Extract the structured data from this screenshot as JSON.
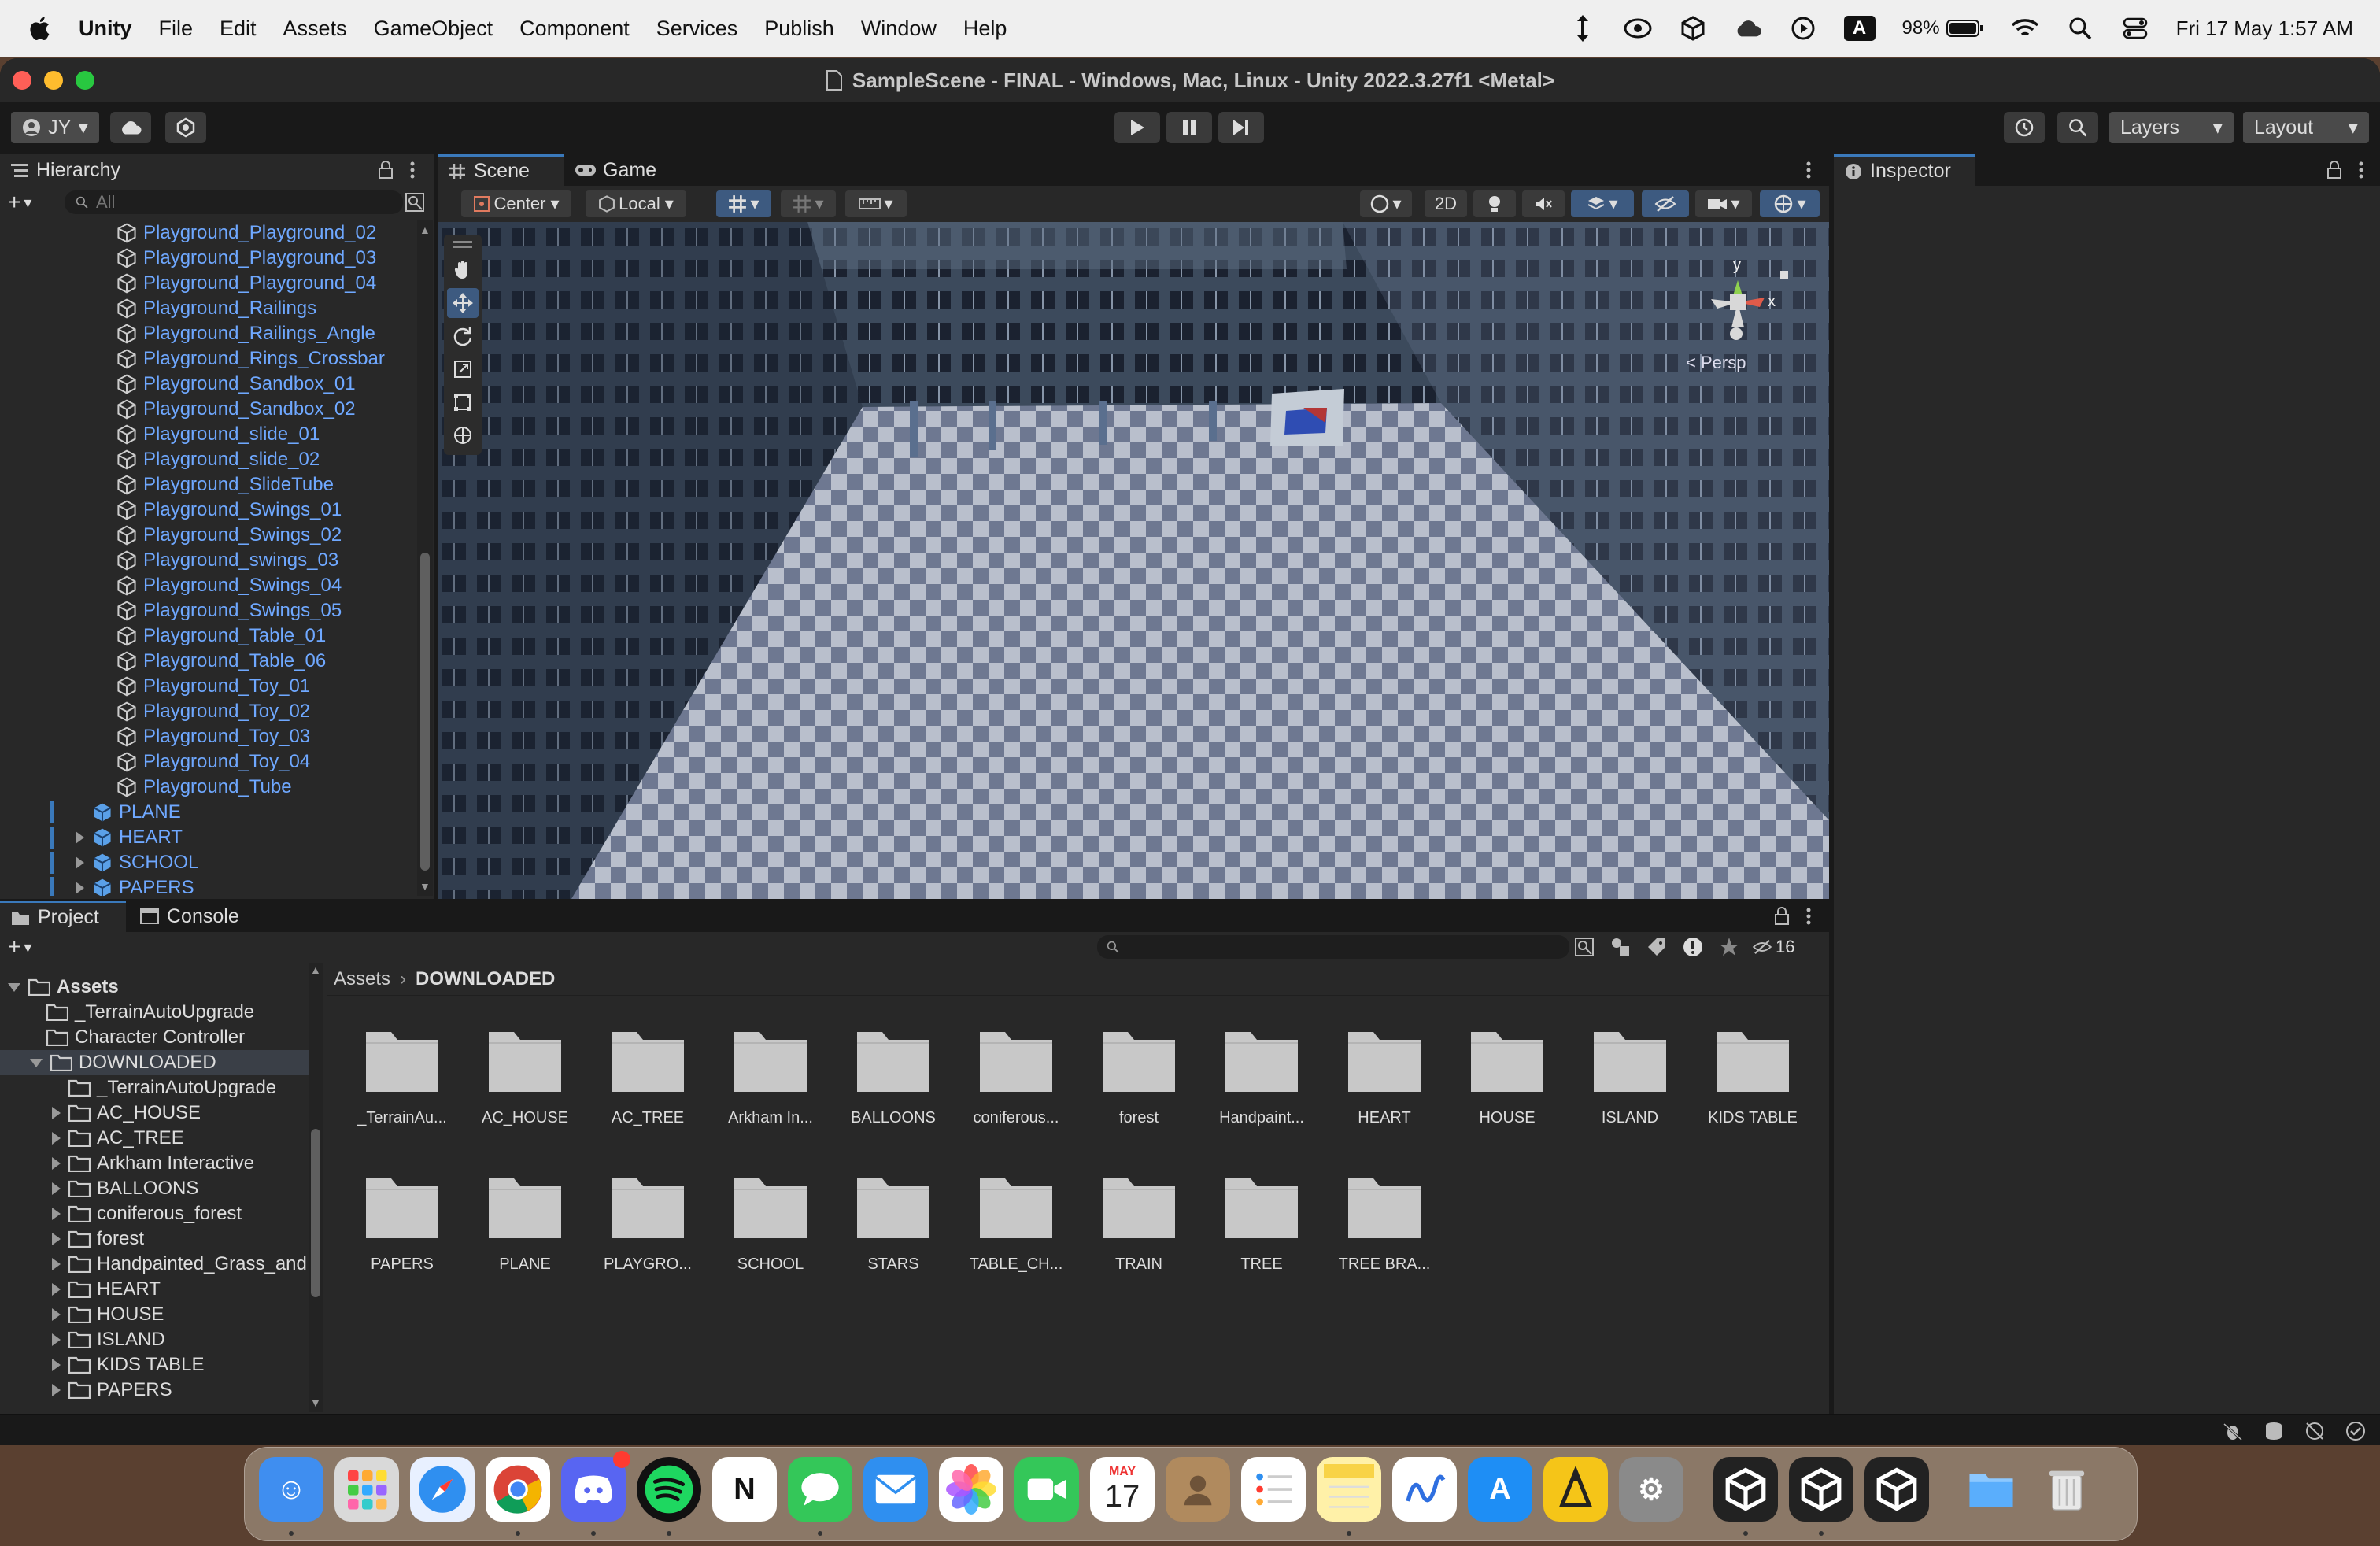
{
  "menubar": {
    "app": "Unity",
    "items": [
      "File",
      "Edit",
      "Assets",
      "GameObject",
      "Component",
      "Services",
      "Publish",
      "Window",
      "Help"
    ],
    "battery": "98%",
    "input_source": "A",
    "datetime": "Fri 17 May  1:57 AM"
  },
  "window": {
    "title": "SampleScene - FINAL - Windows, Mac, Linux - Unity 2022.3.27f1 <Metal>"
  },
  "toolbar": {
    "account": "JY",
    "layers": "Layers",
    "layout": "Layout"
  },
  "hierarchy": {
    "tab": "Hierarchy",
    "search_placeholder": "All",
    "children": [
      "Playground_Playground_02",
      "Playground_Playground_03",
      "Playground_Playground_04",
      "Playground_Railings",
      "Playground_Railings_Angle",
      "Playground_Rings_Crossbar",
      "Playground_Sandbox_01",
      "Playground_Sandbox_02",
      "Playground_slide_01",
      "Playground_slide_02",
      "Playground_SlideTube",
      "Playground_Swings_01",
      "Playground_Swings_02",
      "Playground_swings_03",
      "Playground_Swings_04",
      "Playground_Swings_05",
      "Playground_Table_01",
      "Playground_Table_06",
      "Playground_Toy_01",
      "Playground_Toy_02",
      "Playground_Toy_03",
      "Playground_Toy_04",
      "Playground_Tube"
    ],
    "roots": [
      "PLANE",
      "HEART",
      "SCHOOL",
      "PAPERS"
    ]
  },
  "scene": {
    "tabs": [
      "Scene",
      "Game"
    ],
    "pivot": "Center",
    "space": "Local",
    "mode_2d": "2D",
    "gizmo_y": "y",
    "gizmo_x": "x",
    "persp": "< Persp"
  },
  "inspector": {
    "tab": "Inspector"
  },
  "project": {
    "tabs": [
      "Project",
      "Console"
    ],
    "breadcrumb": [
      "Assets",
      "DOWNLOADED"
    ],
    "hidden_count": "16",
    "tree": [
      {
        "label": "Assets",
        "depth": 0,
        "expanded": true,
        "bold": true
      },
      {
        "label": "_TerrainAutoUpgrade",
        "depth": 1
      },
      {
        "label": "Character Controller",
        "depth": 1
      },
      {
        "label": "DOWNLOADED",
        "depth": 1,
        "expanded": true,
        "selected": true
      },
      {
        "label": "_TerrainAutoUpgrade",
        "depth": 2
      },
      {
        "label": "AC_HOUSE",
        "depth": 2,
        "arrow": true
      },
      {
        "label": "AC_TREE",
        "depth": 2,
        "arrow": true
      },
      {
        "label": "Arkham Interactive",
        "depth": 2,
        "arrow": true
      },
      {
        "label": "BALLOONS",
        "depth": 2,
        "arrow": true
      },
      {
        "label": "coniferous_forest",
        "depth": 2,
        "arrow": true
      },
      {
        "label": "forest",
        "depth": 2,
        "arrow": true
      },
      {
        "label": "Handpainted_Grass_and",
        "depth": 2,
        "arrow": true
      },
      {
        "label": "HEART",
        "depth": 2,
        "arrow": true
      },
      {
        "label": "HOUSE",
        "depth": 2,
        "arrow": true
      },
      {
        "label": "ISLAND",
        "depth": 2,
        "arrow": true
      },
      {
        "label": "KIDS TABLE",
        "depth": 2,
        "arrow": true
      },
      {
        "label": "PAPERS",
        "depth": 2,
        "arrow": true
      }
    ],
    "grid": [
      "_TerrainAu...",
      "AC_HOUSE",
      "AC_TREE",
      "Arkham In...",
      "BALLOONS",
      "coniferous...",
      "forest",
      "Handpaint...",
      "HEART",
      "HOUSE",
      "ISLAND",
      "KIDS TABLE",
      "PAPERS",
      "PLANE",
      "PLAYGRO...",
      "SCHOOL",
      "STARS",
      "TABLE_CH...",
      "TRAIN",
      "TREE",
      "TREE BRA..."
    ]
  },
  "dock": {
    "calendar_month": "MAY",
    "calendar_day": "17",
    "apps": [
      "finder-icon",
      "launchpad-icon",
      "safari-icon",
      "chrome-icon",
      "discord-icon",
      "spotify-icon",
      "notion-icon",
      "messages-icon",
      "mail-icon",
      "photos-icon",
      "facetime-icon",
      "calendar-icon",
      "contacts-icon",
      "reminders-icon",
      "notes-icon",
      "freeform-icon",
      "app-store-icon",
      "instruments-icon",
      "system-settings-icon",
      "unity-hub-icon",
      "unity-icon",
      "unity-icon-2",
      "downloads-folder-icon",
      "trash-icon"
    ]
  },
  "colors": {
    "accent": "#3a79bb",
    "link_blue": "#6fa8ff",
    "panel": "#282828",
    "chrome": "#191919"
  }
}
